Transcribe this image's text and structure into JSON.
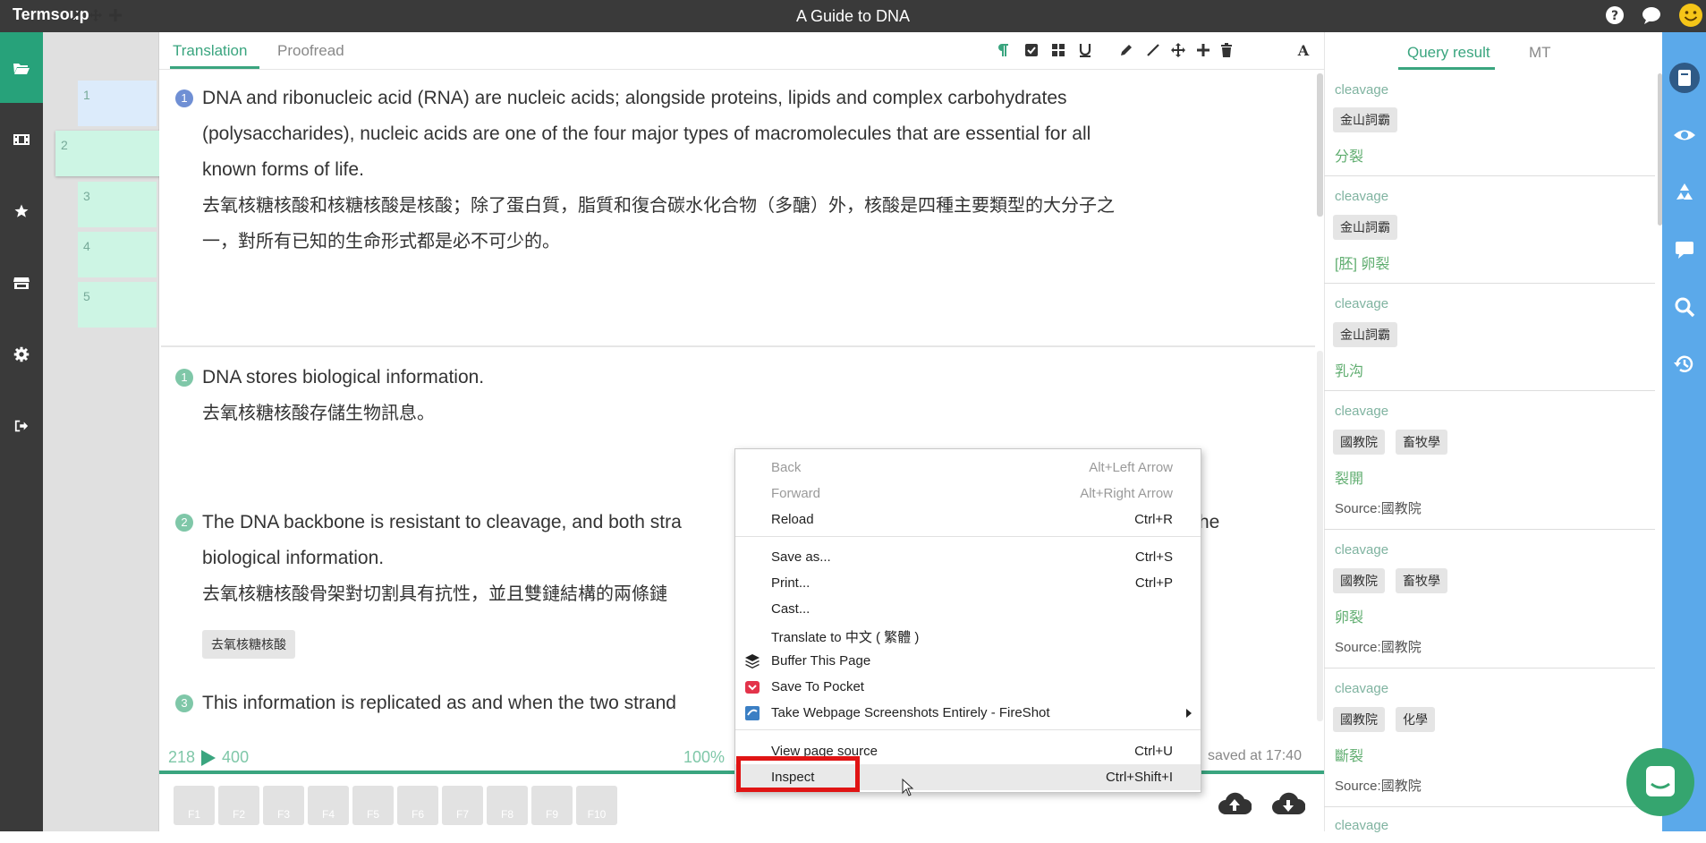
{
  "app": {
    "brand": "Termsoup",
    "title": "A Guide to DNA"
  },
  "segments": [
    "1",
    "2",
    "3",
    "4",
    "5"
  ],
  "tabs": {
    "translation": "Translation",
    "proofread": "Proofread"
  },
  "block1": {
    "num": "1",
    "en_lines": [
      "DNA and ribonucleic acid (RNA) are nucleic acids; alongside proteins, lipids and complex carbohydrates",
      "(polysaccharides), nucleic acids are one of the four major types of macromolecules that are essential for all",
      "known forms of life."
    ],
    "zh_lines": [
      "去氧核糖核酸和核糖核酸是核酸；除了蛋白質，脂質和復合碳水化合物（多醣）外，核酸是四種主要類型的大分子之",
      "一，對所有已知的生命形式都是必不可少的。"
    ]
  },
  "block2": {
    "s1": {
      "num": "1",
      "en": "DNA stores biological information.",
      "zh": "去氧核糖核酸存儲生物訊息。"
    },
    "s2": {
      "num": "2",
      "en1": "The DNA backbone is resistant to cleavage, and both stra",
      "en1_tail": "he",
      "en2": "biological information.",
      "zh": "去氧核糖核酸骨架對切割具有抗性，並且雙鏈結構的兩條鏈",
      "chip": "去氧核糖核酸"
    },
    "s3": {
      "num": "3",
      "en": "This information is replicated as and when the two strand"
    }
  },
  "status": {
    "range_start": "218",
    "range_end": "400",
    "percent": "100%",
    "saved": "saved  at  17:40"
  },
  "fkeys": [
    "F1",
    "F2",
    "F3",
    "F4",
    "F5",
    "F6",
    "F7",
    "F8",
    "F9",
    "F10"
  ],
  "right_tabs": {
    "query": "Query result",
    "mt": "MT"
  },
  "query_results": [
    {
      "term": "cleavage",
      "tags": [
        "金山詞霸"
      ],
      "translation": "分裂",
      "source": ""
    },
    {
      "term": "cleavage",
      "tags": [
        "金山詞霸"
      ],
      "translation": "[胚] 卵裂",
      "source": ""
    },
    {
      "term": "cleavage",
      "tags": [
        "金山詞霸"
      ],
      "translation": "乳沟",
      "source": ""
    },
    {
      "term": "cleavage",
      "tags": [
        "國教院",
        "畜牧學"
      ],
      "translation": "裂開",
      "source": "Source:國教院"
    },
    {
      "term": "cleavage",
      "tags": [
        "國教院",
        "畜牧學"
      ],
      "translation": "卵裂",
      "source": "Source:國教院"
    },
    {
      "term": "cleavage",
      "tags": [
        "國教院",
        "化學"
      ],
      "translation": "斷裂",
      "source": "Source:國教院"
    },
    {
      "term": "cleavage",
      "tags": [],
      "translation": "",
      "source": ""
    }
  ],
  "context_menu": {
    "back": {
      "label": "Back",
      "shortcut": "Alt+Left Arrow"
    },
    "forward": {
      "label": "Forward",
      "shortcut": "Alt+Right Arrow"
    },
    "reload": {
      "label": "Reload",
      "shortcut": "Ctrl+R"
    },
    "save_as": {
      "label": "Save as...",
      "shortcut": "Ctrl+S"
    },
    "print": {
      "label": "Print...",
      "shortcut": "Ctrl+P"
    },
    "cast": {
      "label": "Cast..."
    },
    "translate": {
      "label": "Translate to 中文 ( 繁體 )"
    },
    "buffer": {
      "label": "Buffer This Page"
    },
    "pocket": {
      "label": "Save To Pocket"
    },
    "fireshot": {
      "label": "Take Webpage Screenshots Entirely - FireShot"
    },
    "view_source": {
      "label": "View page source",
      "shortcut": "Ctrl+U"
    },
    "inspect": {
      "label": "Inspect",
      "shortcut": "Ctrl+Shift+I"
    }
  },
  "colors": {
    "accent": "#3aa57f",
    "topbar": "#3a3a3a",
    "right_bar": "#5ba9ea",
    "highlight": "#e01414"
  }
}
